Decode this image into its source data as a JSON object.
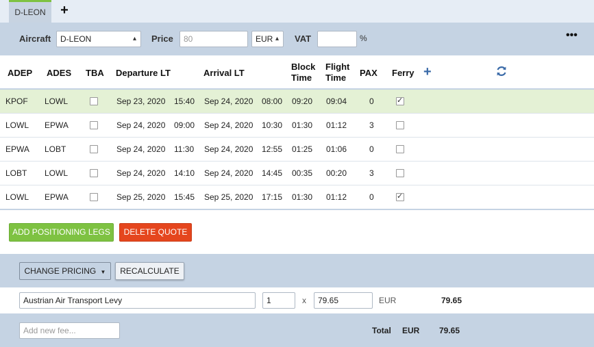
{
  "tabs": {
    "active_label": "D-LEON",
    "add_label": "+"
  },
  "toolbar": {
    "aircraft_label": "Aircraft",
    "aircraft_value": "D-LEON",
    "price_label": "Price",
    "price_placeholder": "80",
    "currency_value": "EUR",
    "vat_label": "VAT",
    "vat_value": "",
    "percent_sign": "%",
    "more_label": "•••"
  },
  "table": {
    "headers": {
      "adep": "ADEP",
      "ades": "ADES",
      "tba": "TBA",
      "departure": "Departure LT",
      "arrival": "Arrival LT",
      "block_time_line1": "Block",
      "block_time_line2": "Time",
      "flight_time_line1": "Flight",
      "flight_time_line2": "Time",
      "pax": "PAX",
      "ferry": "Ferry",
      "add_icon": "plus-icon",
      "refresh_icon": "refresh-icon"
    },
    "rows": [
      {
        "adep": "KPOF",
        "ades": "LOWL",
        "tba": false,
        "dep_date": "Sep 23, 2020",
        "dep_time": "15:40",
        "arr_date": "Sep 24, 2020",
        "arr_time": "08:00",
        "block": "09:20",
        "flight": "09:04",
        "pax": "0",
        "ferry": true
      },
      {
        "adep": "LOWL",
        "ades": "EPWA",
        "tba": false,
        "dep_date": "Sep 24, 2020",
        "dep_time": "09:00",
        "arr_date": "Sep 24, 2020",
        "arr_time": "10:30",
        "block": "01:30",
        "flight": "01:12",
        "pax": "3",
        "ferry": false
      },
      {
        "adep": "EPWA",
        "ades": "LOBT",
        "tba": false,
        "dep_date": "Sep 24, 2020",
        "dep_time": "11:30",
        "arr_date": "Sep 24, 2020",
        "arr_time": "12:55",
        "block": "01:25",
        "flight": "01:06",
        "pax": "0",
        "ferry": false
      },
      {
        "adep": "LOBT",
        "ades": "LOWL",
        "tba": false,
        "dep_date": "Sep 24, 2020",
        "dep_time": "14:10",
        "arr_date": "Sep 24, 2020",
        "arr_time": "14:45",
        "block": "00:35",
        "flight": "00:20",
        "pax": "3",
        "ferry": false
      },
      {
        "adep": "LOWL",
        "ades": "EPWA",
        "tba": false,
        "dep_date": "Sep 25, 2020",
        "dep_time": "15:45",
        "arr_date": "Sep 25, 2020",
        "arr_time": "17:15",
        "block": "01:30",
        "flight": "01:12",
        "pax": "0",
        "ferry": true
      }
    ]
  },
  "actions": {
    "add_positioning_legs": "ADD POSITIONING LEGS",
    "delete_quote": "DELETE QUOTE"
  },
  "pricing": {
    "change_pricing_label": "CHANGE PRICING",
    "recalculate_label": "RECALCULATE",
    "fees": [
      {
        "name": "Austrian Air Transport Levy",
        "quantity": "1",
        "times": "x",
        "unit_price": "79.65",
        "currency": "EUR",
        "amount": "79.65"
      }
    ],
    "new_fee_placeholder": "Add new fee...",
    "total_label": "Total",
    "total_currency": "EUR",
    "total_amount": "79.65"
  },
  "colors": {
    "accent_green": "#7ec242",
    "danger_red": "#e5461e",
    "panel_blue": "#c5d3e3",
    "selected_row": "#e4f1d5",
    "icon_blue": "#3a6aa8"
  }
}
